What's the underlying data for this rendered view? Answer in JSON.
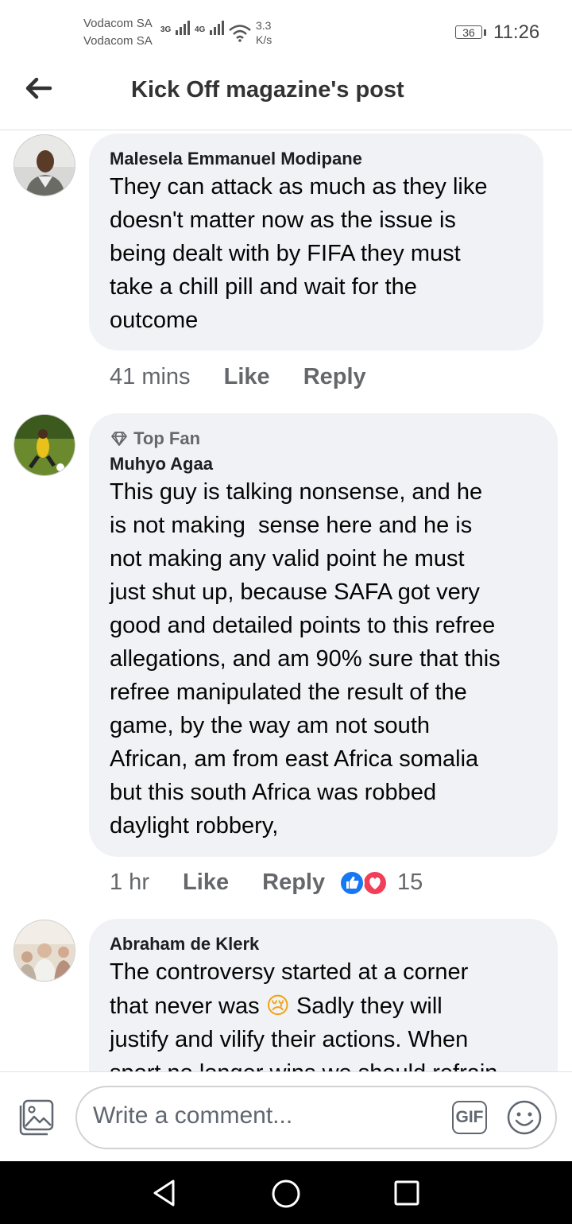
{
  "status_bar": {
    "carrier1": "Vodacom SA",
    "carrier2": "Vodacom SA",
    "net1": "3G",
    "net2": "4G",
    "speed_value": "3.3",
    "speed_unit": "K/s",
    "battery": "36",
    "time": "11:26"
  },
  "header": {
    "title": "Kick Off magazine's post",
    "back_icon": "arrow-left-icon"
  },
  "comments": [
    {
      "author": "Malesela Emmanuel Modipane",
      "lines": [
        "They can attack as much as they like",
        "doesn't matter now as the issue is",
        "being dealt with by FIFA they must",
        "take a chill pill and wait for the",
        "outcome"
      ],
      "time": "41 mins",
      "like": "Like",
      "reply": "Reply"
    },
    {
      "badge": "Top Fan",
      "author": "Muhyo Agaa",
      "lines": [
        "This guy is talking nonsense, and he",
        "is not making  sense here and he is",
        "not making any valid point he must",
        "just shut up, because SAFA got very",
        "good and detailed points to this refree",
        "allegations, and am 90% sure that this",
        "refree manipulated the result of the",
        "game, by the way am not south",
        "African, am from east Africa somalia",
        "but this south Africa was robbed",
        "daylight robbery,"
      ],
      "time": "1 hr",
      "like": "Like",
      "reply": "Reply",
      "reactions": "15"
    },
    {
      "author": "Abraham de Klerk",
      "lines": [
        "The controversy started at a corner",
        "that never was",
        "Sadly they will",
        "justify and vilify their actions. When",
        "sport no longer wins we should refrain"
      ],
      "emoji": "😢"
    }
  ],
  "composer": {
    "placeholder": "Write a comment...",
    "gif": "GIF"
  },
  "colors": {
    "like_blue": "#1877f2",
    "love_red": "#f33e58",
    "bubble": "#f0f2f5"
  }
}
